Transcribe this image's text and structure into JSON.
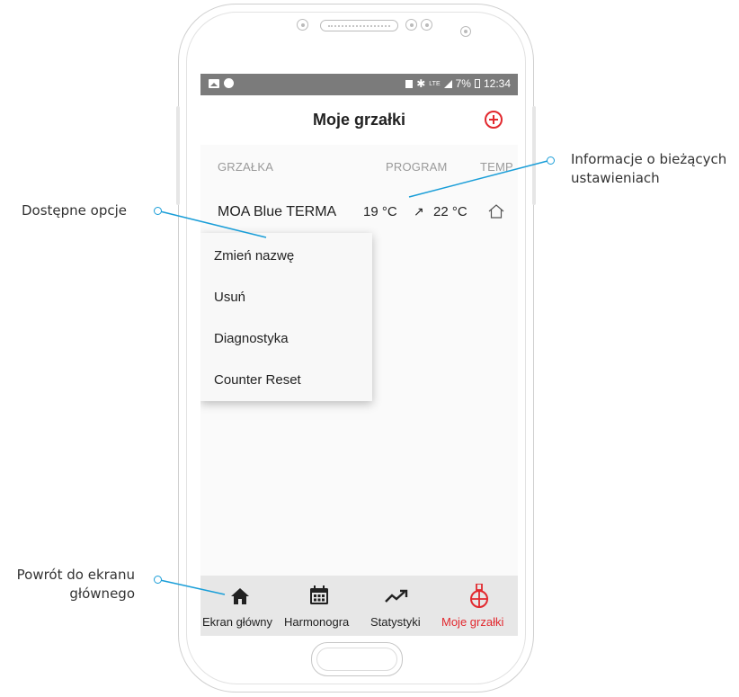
{
  "status_bar": {
    "network": "LTE",
    "battery": "7%",
    "time": "12:34"
  },
  "app_bar": {
    "title": "Moje grzałki",
    "add_icon": "plus-circle-icon",
    "accent": "#e2292f"
  },
  "table": {
    "headers": [
      "GRZAŁKA",
      "PROGRAM",
      "TEMP"
    ],
    "rows": [
      {
        "name": "MOA Blue TERMA",
        "temp_current": "19 °C",
        "trend_icon": "arrow-up-right-icon",
        "temp_target": "22 °C",
        "mode_icon": "house-icon"
      }
    ]
  },
  "menu": {
    "items": [
      "Zmień nazwę",
      "Usuń",
      "Diagnostyka",
      "Counter Reset"
    ]
  },
  "bottom_nav": {
    "items": [
      {
        "label": "Ekran główny",
        "icon": "home-icon"
      },
      {
        "label": "Harmonogra",
        "icon": "calendar-icon"
      },
      {
        "label": "Statystyki",
        "icon": "trend-chart-icon"
      },
      {
        "label": "Moje grzałki",
        "icon": "heater-icon",
        "active": true
      }
    ]
  },
  "callouts": {
    "options": "Dostępne opcje",
    "info_line1": "Informacje o bieżących",
    "info_line2": "ustawieniach",
    "home_line1": "Powrót do ekranu",
    "home_line2": "głównego",
    "color": "#1a9ed8"
  }
}
